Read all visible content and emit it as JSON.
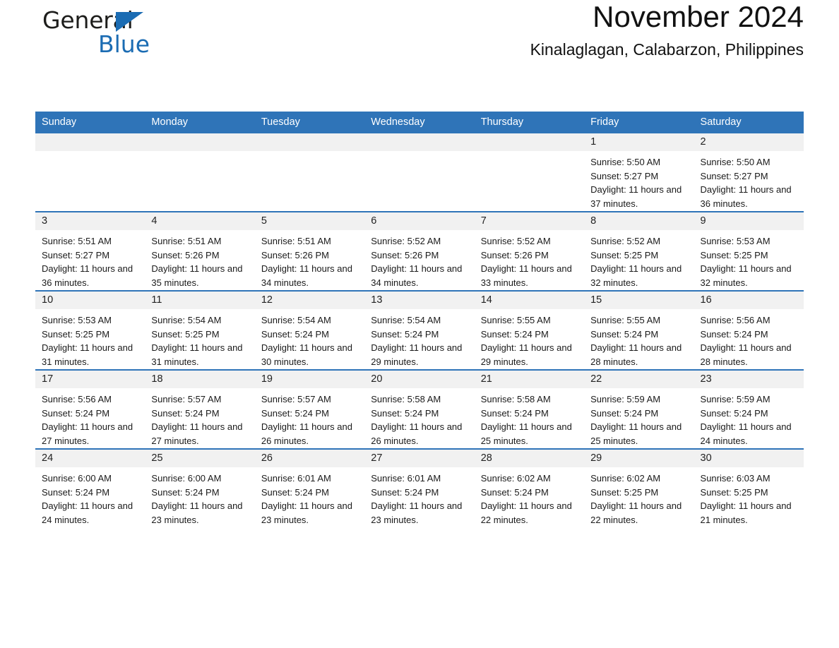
{
  "brand": {
    "name_part1": "General",
    "name_part2": "Blue",
    "accent_color": "#1b6cb3"
  },
  "header": {
    "title": "November 2024",
    "location": "Kinalaglagan, Calabarzon, Philippines"
  },
  "theme": {
    "header_blue": "#2f74b8",
    "daynum_band": "#f1f1f1"
  },
  "calendar": {
    "weekday_headers": [
      "Sunday",
      "Monday",
      "Tuesday",
      "Wednesday",
      "Thursday",
      "Friday",
      "Saturday"
    ],
    "weeks": [
      [
        {
          "day": "",
          "empty": true
        },
        {
          "day": "",
          "empty": true
        },
        {
          "day": "",
          "empty": true
        },
        {
          "day": "",
          "empty": true
        },
        {
          "day": "",
          "empty": true
        },
        {
          "day": "1",
          "sunrise": "Sunrise: 5:50 AM",
          "sunset": "Sunset: 5:27 PM",
          "daylight": "Daylight: 11 hours and 37 minutes."
        },
        {
          "day": "2",
          "sunrise": "Sunrise: 5:50 AM",
          "sunset": "Sunset: 5:27 PM",
          "daylight": "Daylight: 11 hours and 36 minutes."
        }
      ],
      [
        {
          "day": "3",
          "sunrise": "Sunrise: 5:51 AM",
          "sunset": "Sunset: 5:27 PM",
          "daylight": "Daylight: 11 hours and 36 minutes."
        },
        {
          "day": "4",
          "sunrise": "Sunrise: 5:51 AM",
          "sunset": "Sunset: 5:26 PM",
          "daylight": "Daylight: 11 hours and 35 minutes."
        },
        {
          "day": "5",
          "sunrise": "Sunrise: 5:51 AM",
          "sunset": "Sunset: 5:26 PM",
          "daylight": "Daylight: 11 hours and 34 minutes."
        },
        {
          "day": "6",
          "sunrise": "Sunrise: 5:52 AM",
          "sunset": "Sunset: 5:26 PM",
          "daylight": "Daylight: 11 hours and 34 minutes."
        },
        {
          "day": "7",
          "sunrise": "Sunrise: 5:52 AM",
          "sunset": "Sunset: 5:26 PM",
          "daylight": "Daylight: 11 hours and 33 minutes."
        },
        {
          "day": "8",
          "sunrise": "Sunrise: 5:52 AM",
          "sunset": "Sunset: 5:25 PM",
          "daylight": "Daylight: 11 hours and 32 minutes."
        },
        {
          "day": "9",
          "sunrise": "Sunrise: 5:53 AM",
          "sunset": "Sunset: 5:25 PM",
          "daylight": "Daylight: 11 hours and 32 minutes."
        }
      ],
      [
        {
          "day": "10",
          "sunrise": "Sunrise: 5:53 AM",
          "sunset": "Sunset: 5:25 PM",
          "daylight": "Daylight: 11 hours and 31 minutes."
        },
        {
          "day": "11",
          "sunrise": "Sunrise: 5:54 AM",
          "sunset": "Sunset: 5:25 PM",
          "daylight": "Daylight: 11 hours and 31 minutes."
        },
        {
          "day": "12",
          "sunrise": "Sunrise: 5:54 AM",
          "sunset": "Sunset: 5:24 PM",
          "daylight": "Daylight: 11 hours and 30 minutes."
        },
        {
          "day": "13",
          "sunrise": "Sunrise: 5:54 AM",
          "sunset": "Sunset: 5:24 PM",
          "daylight": "Daylight: 11 hours and 29 minutes."
        },
        {
          "day": "14",
          "sunrise": "Sunrise: 5:55 AM",
          "sunset": "Sunset: 5:24 PM",
          "daylight": "Daylight: 11 hours and 29 minutes."
        },
        {
          "day": "15",
          "sunrise": "Sunrise: 5:55 AM",
          "sunset": "Sunset: 5:24 PM",
          "daylight": "Daylight: 11 hours and 28 minutes."
        },
        {
          "day": "16",
          "sunrise": "Sunrise: 5:56 AM",
          "sunset": "Sunset: 5:24 PM",
          "daylight": "Daylight: 11 hours and 28 minutes."
        }
      ],
      [
        {
          "day": "17",
          "sunrise": "Sunrise: 5:56 AM",
          "sunset": "Sunset: 5:24 PM",
          "daylight": "Daylight: 11 hours and 27 minutes."
        },
        {
          "day": "18",
          "sunrise": "Sunrise: 5:57 AM",
          "sunset": "Sunset: 5:24 PM",
          "daylight": "Daylight: 11 hours and 27 minutes."
        },
        {
          "day": "19",
          "sunrise": "Sunrise: 5:57 AM",
          "sunset": "Sunset: 5:24 PM",
          "daylight": "Daylight: 11 hours and 26 minutes."
        },
        {
          "day": "20",
          "sunrise": "Sunrise: 5:58 AM",
          "sunset": "Sunset: 5:24 PM",
          "daylight": "Daylight: 11 hours and 26 minutes."
        },
        {
          "day": "21",
          "sunrise": "Sunrise: 5:58 AM",
          "sunset": "Sunset: 5:24 PM",
          "daylight": "Daylight: 11 hours and 25 minutes."
        },
        {
          "day": "22",
          "sunrise": "Sunrise: 5:59 AM",
          "sunset": "Sunset: 5:24 PM",
          "daylight": "Daylight: 11 hours and 25 minutes."
        },
        {
          "day": "23",
          "sunrise": "Sunrise: 5:59 AM",
          "sunset": "Sunset: 5:24 PM",
          "daylight": "Daylight: 11 hours and 24 minutes."
        }
      ],
      [
        {
          "day": "24",
          "sunrise": "Sunrise: 6:00 AM",
          "sunset": "Sunset: 5:24 PM",
          "daylight": "Daylight: 11 hours and 24 minutes."
        },
        {
          "day": "25",
          "sunrise": "Sunrise: 6:00 AM",
          "sunset": "Sunset: 5:24 PM",
          "daylight": "Daylight: 11 hours and 23 minutes."
        },
        {
          "day": "26",
          "sunrise": "Sunrise: 6:01 AM",
          "sunset": "Sunset: 5:24 PM",
          "daylight": "Daylight: 11 hours and 23 minutes."
        },
        {
          "day": "27",
          "sunrise": "Sunrise: 6:01 AM",
          "sunset": "Sunset: 5:24 PM",
          "daylight": "Daylight: 11 hours and 23 minutes."
        },
        {
          "day": "28",
          "sunrise": "Sunrise: 6:02 AM",
          "sunset": "Sunset: 5:24 PM",
          "daylight": "Daylight: 11 hours and 22 minutes."
        },
        {
          "day": "29",
          "sunrise": "Sunrise: 6:02 AM",
          "sunset": "Sunset: 5:25 PM",
          "daylight": "Daylight: 11 hours and 22 minutes."
        },
        {
          "day": "30",
          "sunrise": "Sunrise: 6:03 AM",
          "sunset": "Sunset: 5:25 PM",
          "daylight": "Daylight: 11 hours and 21 minutes."
        }
      ]
    ]
  }
}
